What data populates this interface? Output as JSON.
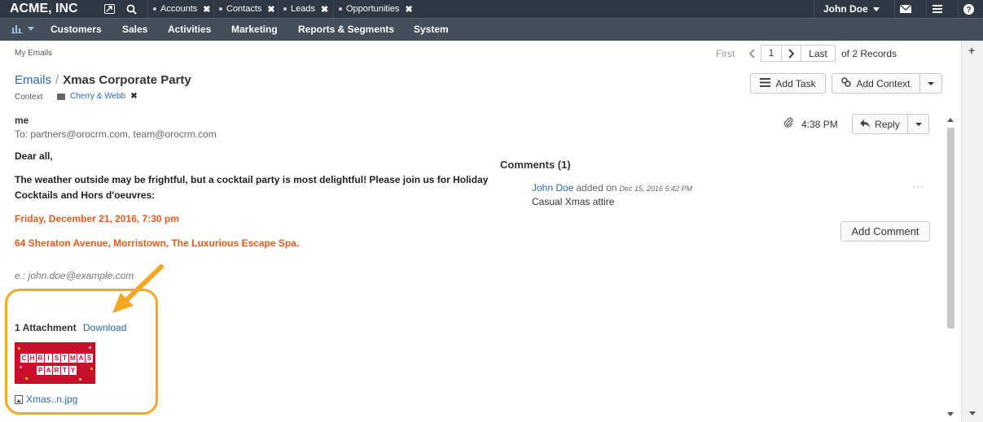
{
  "topbar": {
    "brand": "ACME, INC",
    "tabs": [
      {
        "label": "Accounts"
      },
      {
        "label": "Contacts"
      },
      {
        "label": "Leads"
      },
      {
        "label": "Opportunities"
      }
    ],
    "user": "John Doe"
  },
  "nav": {
    "items": [
      "Customers",
      "Sales",
      "Activities",
      "Marketing",
      "Reports & Segments",
      "System"
    ]
  },
  "breadcrumb": "My Emails",
  "pager": {
    "first": "First",
    "page": "1",
    "last": "Last",
    "records": "of 2 Records"
  },
  "title": {
    "section": "Emails",
    "separator": "/",
    "subject": "Xmas Corporate Party"
  },
  "context": {
    "label": "Context",
    "tag": "Cherry & Webb"
  },
  "actions": {
    "add_task": "Add Task",
    "add_context": "Add Context"
  },
  "email": {
    "from": "me",
    "to": "To: partners@orocrm.com, team@orocrm.com",
    "time": "4:38 PM",
    "reply": "Reply",
    "greeting": "Dear all,",
    "line1": "The weather outside may be frightful, but a cocktail party is most delightful! Please join us for Holiday",
    "line2": "Cocktails and Hors d'oeuvres:",
    "date_line": "Friday, December 21, 2016, 7:30 pm",
    "address_line": "64 Sheraton Avenue, Morristown, The Luxurious Escape Spa.",
    "signature": "e.: john.doe@example.com"
  },
  "attachments": {
    "label": "1 Attachment",
    "download": "Download",
    "thumb_row1": [
      "C",
      "H",
      "R",
      "I",
      "S",
      "T",
      "M",
      "A",
      "S"
    ],
    "thumb_row2": [
      "P",
      "A",
      "R",
      "T",
      "Y"
    ],
    "filename": "Xmas..n.jpg"
  },
  "comments": {
    "heading": "Comments (1)",
    "author": "John Doe",
    "added": "added on",
    "date": "Dec 15, 2016 5:42 PM",
    "text": "Casual Xmas attire",
    "more": "···",
    "add_button": "Add Comment"
  },
  "colors": {
    "topbar": "#2f3742",
    "navbar": "#434e59",
    "link": "#2a6ab4",
    "orange_text": "#e85a1c",
    "highlight": "#f5a623"
  }
}
